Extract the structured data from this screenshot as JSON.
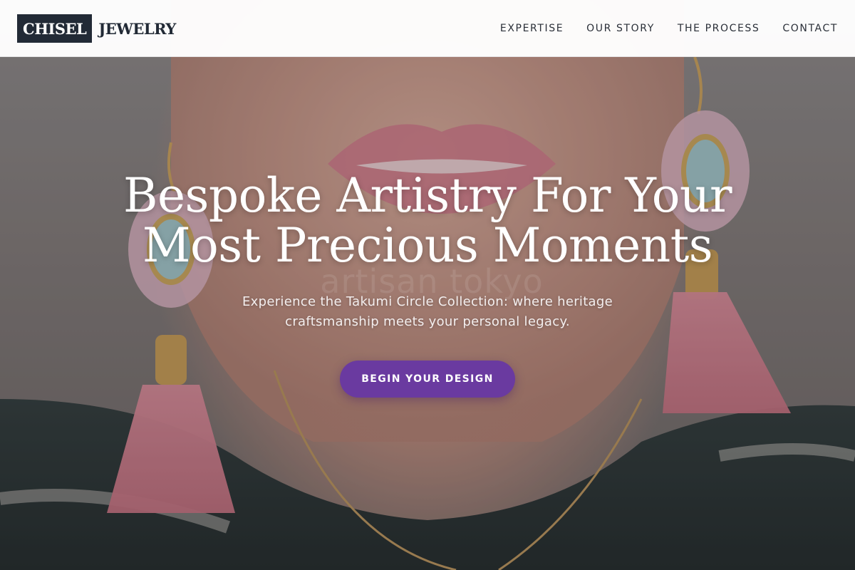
{
  "brand": {
    "logo_part1": "CHISEL",
    "logo_part2": "JEWELRY"
  },
  "nav": {
    "items": [
      {
        "label": "EXPERTISE"
      },
      {
        "label": "OUR STORY"
      },
      {
        "label": "THE PROCESS"
      },
      {
        "label": "CONTACT"
      }
    ]
  },
  "hero": {
    "headline_line1": "Bespoke Artistry For Your",
    "headline_line2": "Most Precious Moments",
    "subtext_line1": "Experience the Takumi Circle Collection: where heritage",
    "subtext_line2": "craftsmanship meets your personal legacy.",
    "cta_label": "BEGIN YOUR DESIGN",
    "watermark": "artisan tokyo",
    "image_icon": "portrait-with-tassel-earrings"
  },
  "colors": {
    "brand_dark": "#222a36",
    "cta_purple": "#6a3aa0",
    "header_bg": "#ffffff"
  }
}
